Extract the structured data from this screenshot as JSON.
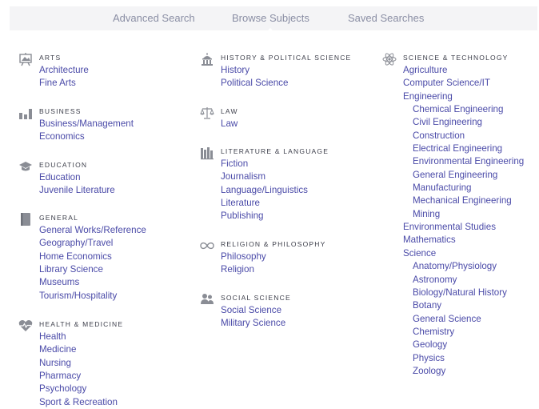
{
  "nav": {
    "tabs": [
      {
        "label": "Advanced Search"
      },
      {
        "label": "Browse Subjects"
      },
      {
        "label": "Saved Searches"
      }
    ],
    "active": "Browse Subjects"
  },
  "colors": {
    "link": "#4a4aa8",
    "heading": "#3c3e4a",
    "icon": "#8a8d95",
    "nav_bg": "#f4f4f6"
  },
  "columns": [
    {
      "categories": [
        {
          "heading": "ARTS",
          "icon": "easel-icon",
          "links": [
            "Architecture",
            "Fine Arts"
          ]
        },
        {
          "heading": "BUSINESS",
          "icon": "bar-chart-icon",
          "links": [
            "Business/Management",
            "Economics"
          ]
        },
        {
          "heading": "EDUCATION",
          "icon": "graduation-cap-icon",
          "links": [
            "Education",
            "Juvenile Literature"
          ]
        },
        {
          "heading": "GENERAL",
          "icon": "book-icon",
          "links": [
            "General Works/Reference",
            "Geography/Travel",
            "Home Economics",
            "Library Science",
            "Museums",
            "Tourism/Hospitality"
          ]
        },
        {
          "heading": "HEALTH & MEDICINE",
          "icon": "heart-pulse-icon",
          "links": [
            "Health",
            "Medicine",
            "Nursing",
            "Pharmacy",
            "Psychology",
            "Sport & Recreation"
          ]
        }
      ]
    },
    {
      "categories": [
        {
          "heading": "HISTORY & POLITICAL SCIENCE",
          "icon": "government-building-icon",
          "links": [
            "History",
            "Political Science"
          ]
        },
        {
          "heading": "LAW",
          "icon": "scales-icon",
          "links": [
            "Law"
          ]
        },
        {
          "heading": "LITERATURE & LANGUAGE",
          "icon": "books-icon",
          "links": [
            "Fiction",
            "Journalism",
            "Language/Linguistics",
            "Literature",
            "Publishing"
          ]
        },
        {
          "heading": "RELIGION & PHILOSOPHY",
          "icon": "infinity-icon",
          "links": [
            "Philosophy",
            "Religion"
          ]
        },
        {
          "heading": "SOCIAL SCIENCE",
          "icon": "people-icon",
          "links": [
            "Social Science",
            "Military Science"
          ]
        }
      ]
    },
    {
      "categories": [
        {
          "heading": "SCIENCE & TECHNOLOGY",
          "icon": "atom-icon",
          "links": [
            {
              "label": "Agriculture"
            },
            {
              "label": "Computer Science/IT"
            },
            {
              "label": "Engineering"
            },
            {
              "label": "Chemical Engineering",
              "sub": true
            },
            {
              "label": "Civil Engineering",
              "sub": true
            },
            {
              "label": "Construction",
              "sub": true
            },
            {
              "label": "Electrical Engineering",
              "sub": true
            },
            {
              "label": "Environmental Engineering",
              "sub": true
            },
            {
              "label": "General Engineering",
              "sub": true
            },
            {
              "label": "Manufacturing",
              "sub": true
            },
            {
              "label": "Mechanical Engineering",
              "sub": true
            },
            {
              "label": "Mining",
              "sub": true
            },
            {
              "label": "Environmental Studies"
            },
            {
              "label": "Mathematics"
            },
            {
              "label": "Science"
            },
            {
              "label": "Anatomy/Physiology",
              "sub": true
            },
            {
              "label": "Astronomy",
              "sub": true
            },
            {
              "label": "Biology/Natural History",
              "sub": true
            },
            {
              "label": "Botany",
              "sub": true
            },
            {
              "label": "General Science",
              "sub": true
            },
            {
              "label": "Chemistry",
              "sub": true
            },
            {
              "label": "Geology",
              "sub": true
            },
            {
              "label": "Physics",
              "sub": true
            },
            {
              "label": "Zoology",
              "sub": true
            }
          ]
        }
      ]
    }
  ]
}
